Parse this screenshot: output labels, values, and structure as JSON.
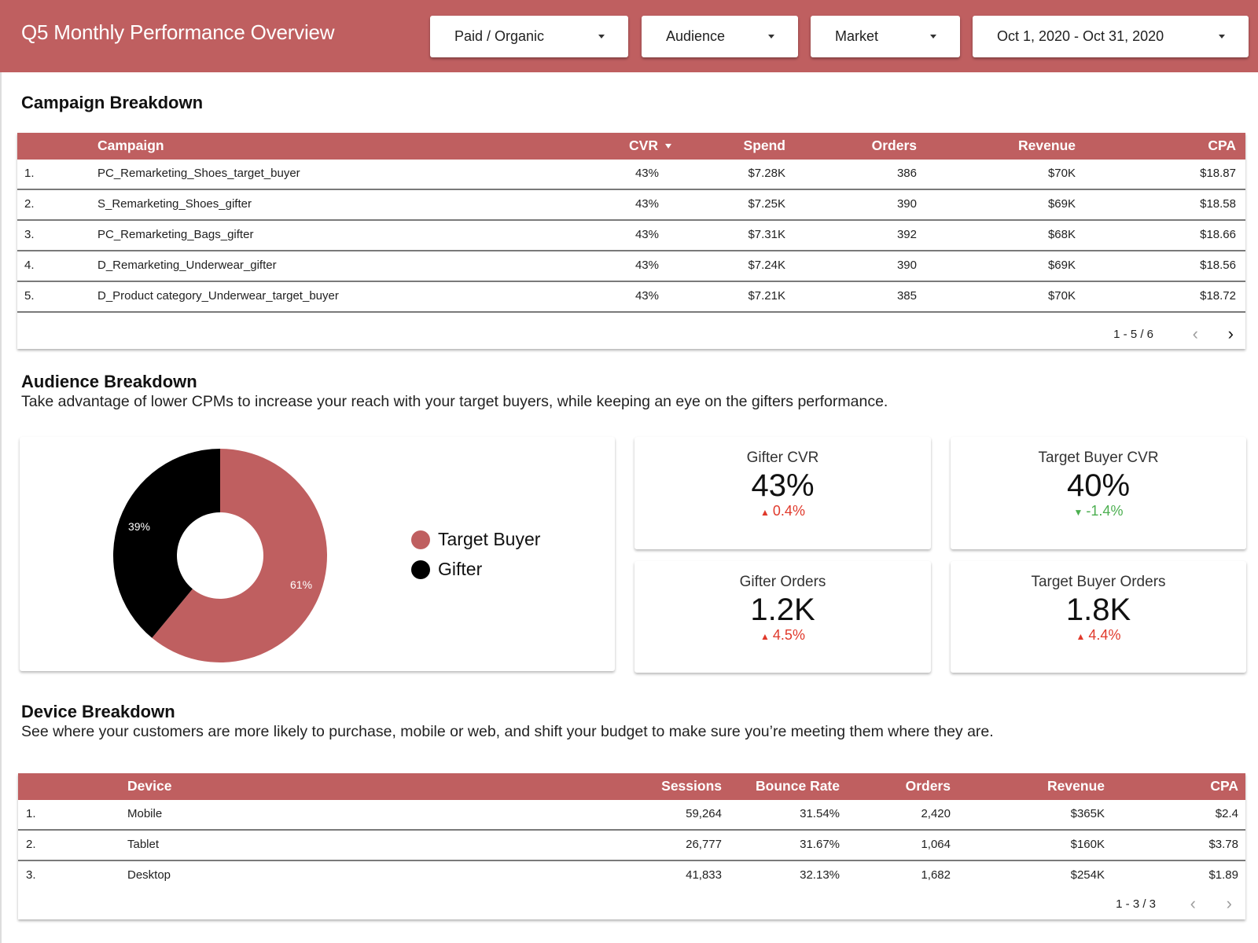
{
  "header": {
    "title": "Q5 Monthly Performance Overview",
    "filters": [
      {
        "label": "Paid / Organic"
      },
      {
        "label": "Audience"
      },
      {
        "label": "Market"
      },
      {
        "label": "Oct 1, 2020 - Oct 31, 2020"
      }
    ]
  },
  "colors": {
    "accent": "#bf5f60",
    "target_buyer": "#bf5f60",
    "gifter": "#000000",
    "delta_up": "#e0392b",
    "delta_down": "#4caf50"
  },
  "campaign": {
    "title": "Campaign Breakdown",
    "columns": [
      "Campaign",
      "CVR",
      "Spend",
      "Orders",
      "Revenue",
      "CPA"
    ],
    "sorted_by": "CVR",
    "rows": [
      {
        "idx": "1.",
        "campaign": "PC_Remarketing_Shoes_target_buyer",
        "cvr": "43%",
        "spend": "$7.28K",
        "orders": "386",
        "revenue": "$70K",
        "cpa": "$18.87"
      },
      {
        "idx": "2.",
        "campaign": "S_Remarketing_Shoes_gifter",
        "cvr": "43%",
        "spend": "$7.25K",
        "orders": "390",
        "revenue": "$69K",
        "cpa": "$18.58"
      },
      {
        "idx": "3.",
        "campaign": "PC_Remarketing_Bags_gifter",
        "cvr": "43%",
        "spend": "$7.31K",
        "orders": "392",
        "revenue": "$68K",
        "cpa": "$18.66"
      },
      {
        "idx": "4.",
        "campaign": "D_Remarketing_Underwear_gifter",
        "cvr": "43%",
        "spend": "$7.24K",
        "orders": "390",
        "revenue": "$69K",
        "cpa": "$18.56"
      },
      {
        "idx": "5.",
        "campaign": "D_Product category_Underwear_target_buyer",
        "cvr": "43%",
        "spend": "$7.21K",
        "orders": "385",
        "revenue": "$70K",
        "cpa": "$18.72"
      }
    ],
    "pagination": "1 - 5 / 6",
    "prev_icon": "‹",
    "next_icon": "›"
  },
  "audience": {
    "title": "Audience Breakdown",
    "description": "Take advantage of lower CPMs to increase your reach with your target buyers, while keeping an eye on the gifters performance.",
    "kpis": [
      {
        "label": "Gifter CVR",
        "value": "43%",
        "delta": "0.4%",
        "direction": "up"
      },
      {
        "label": "Target Buyer CVR",
        "value": "40%",
        "delta": "-1.4%",
        "direction": "down"
      },
      {
        "label": "Gifter Orders",
        "value": "1.2K",
        "delta": "4.5%",
        "direction": "up"
      },
      {
        "label": "Target Buyer Orders",
        "value": "1.8K",
        "delta": "4.4%",
        "direction": "up"
      }
    ],
    "arrow_up": "▲",
    "arrow_down": "▼"
  },
  "chart_data": {
    "type": "pie",
    "donut": true,
    "title": "",
    "legend_position": "right",
    "slices": [
      {
        "label": "Target Buyer",
        "value": 61,
        "display": "61%",
        "color": "#bf5f60"
      },
      {
        "label": "Gifter",
        "value": 39,
        "display": "39%",
        "color": "#000000"
      }
    ]
  },
  "device": {
    "title": "Device Breakdown",
    "description": "See where your customers are more likely to purchase, mobile or web, and shift your budget to make sure you’re meeting them where they are.",
    "columns": [
      "Device",
      "Sessions",
      "Bounce Rate",
      "Orders",
      "Revenue",
      "CPA"
    ],
    "rows": [
      {
        "idx": "1.",
        "device": "Mobile",
        "sessions": "59,264",
        "bounce": "31.54%",
        "orders": "2,420",
        "revenue": "$365K",
        "cpa": "$2.4"
      },
      {
        "idx": "2.",
        "device": "Tablet",
        "sessions": "26,777",
        "bounce": "31.67%",
        "orders": "1,064",
        "revenue": "$160K",
        "cpa": "$3.78"
      },
      {
        "idx": "3.",
        "device": "Desktop",
        "sessions": "41,833",
        "bounce": "32.13%",
        "orders": "1,682",
        "revenue": "$254K",
        "cpa": "$1.89"
      }
    ],
    "pagination": "1 - 3 / 3",
    "prev_icon": "‹",
    "next_icon": "›"
  }
}
